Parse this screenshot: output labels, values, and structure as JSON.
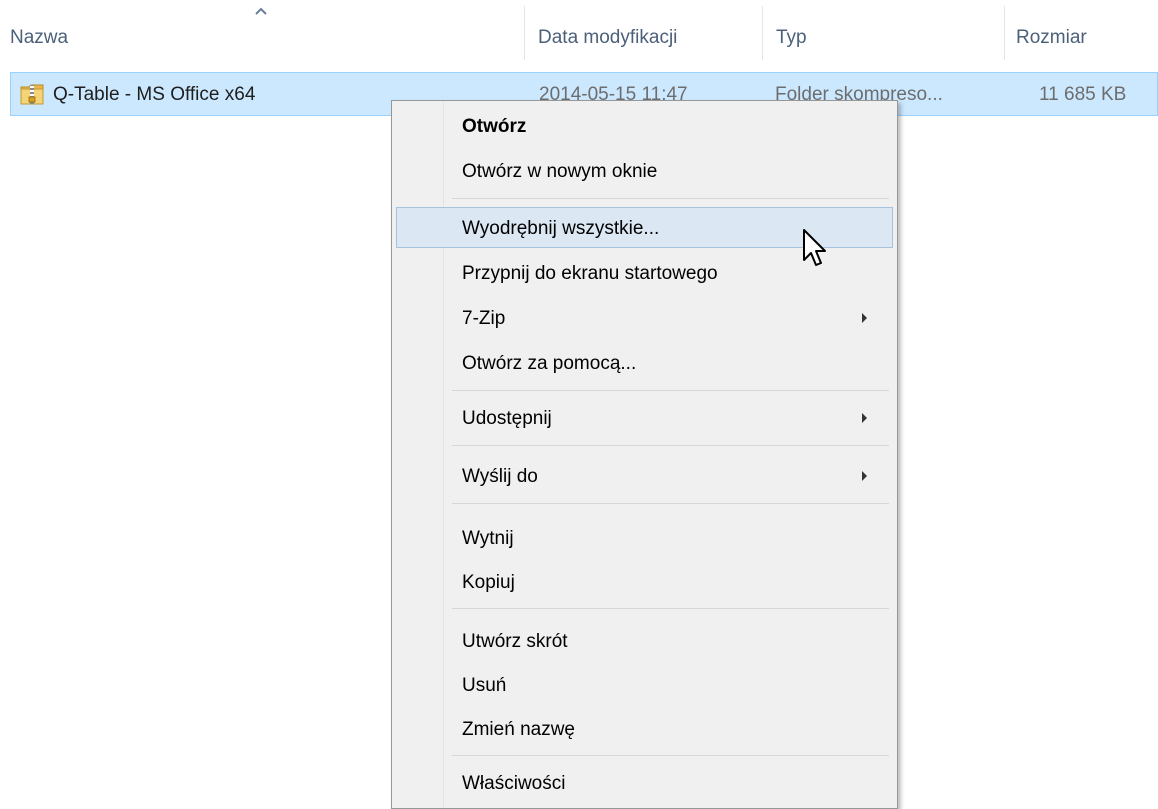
{
  "columns": {
    "name": "Nazwa",
    "date": "Data modyfikacji",
    "type": "Typ",
    "size": "Rozmiar"
  },
  "file": {
    "name": "Q-Table - MS Office x64",
    "date": "2014-05-15 11:47",
    "type": "Folder skompreso...",
    "size": "11 685 KB",
    "icon": "zip-folder-icon"
  },
  "menu": {
    "open": "Otwórz",
    "open_new_window": "Otwórz w nowym oknie",
    "extract_all": "Wyodrębnij wszystkie...",
    "pin_start": "Przypnij do ekranu startowego",
    "seven_zip": "7-Zip",
    "open_with": "Otwórz za pomocą...",
    "share": "Udostępnij",
    "send_to": "Wyślij do",
    "cut": "Wytnij",
    "copy": "Kopiuj",
    "create_shortcut": "Utwórz skrót",
    "delete": "Usuń",
    "rename": "Zmień nazwę",
    "properties": "Właściwości"
  },
  "colors": {
    "selection": "#cce8ff",
    "menu_hover": "#dbe7f3",
    "header_text": "#4c607a"
  }
}
